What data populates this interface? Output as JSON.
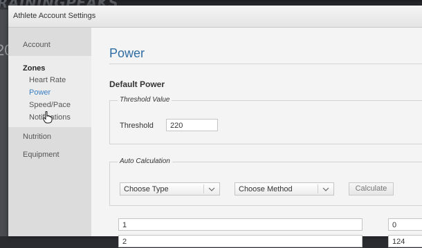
{
  "background": {
    "logo_text": "RAININGPEAKS",
    "left_number": "20"
  },
  "window": {
    "title": "Athlete Account Settings"
  },
  "sidebar": {
    "account": "Account",
    "zones": "Zones",
    "zone_items": [
      "Heart Rate",
      "Power",
      "Speed/Pace",
      "Notifications"
    ],
    "active_item": "Power",
    "nutrition": "Nutrition",
    "equipment": "Equipment"
  },
  "main": {
    "title": "Power",
    "section_title": "Default Power",
    "threshold_fieldset": {
      "legend": "Threshold Value",
      "label": "Threshold",
      "value": "220"
    },
    "auto_calc_fieldset": {
      "legend": "Auto Calculation",
      "type_select": "Choose Type",
      "method_select": "Choose Method",
      "calculate_button": "Calculate"
    },
    "zone_rows": [
      {
        "index": "1",
        "value": "0"
      },
      {
        "index": "2",
        "value": "124"
      }
    ]
  },
  "colors": {
    "accent": "#2e6da4",
    "active_link": "#3b7fc4",
    "sidebar_bg": "#ececec",
    "main_bg": "#f4f4f4"
  },
  "icons": [
    "chevron-down-icon",
    "hand-pointer-cursor-icon"
  ]
}
